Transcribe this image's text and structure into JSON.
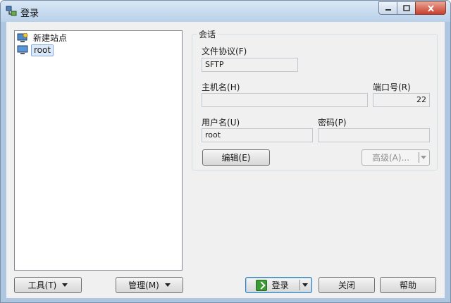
{
  "window": {
    "title": "登录"
  },
  "tree": {
    "items": [
      {
        "label": "新建站点"
      },
      {
        "label": "root"
      }
    ]
  },
  "session": {
    "group_title": "会话",
    "protocol_label": "文件协议",
    "protocol_hotkey": "(F)",
    "protocol_value": "SFTP",
    "host_label": "主机名",
    "host_hotkey": "(H)",
    "host_value": "",
    "port_label": "端口号",
    "port_hotkey": "(R)",
    "port_value": "22",
    "user_label": "用户名",
    "user_hotkey": "(U)",
    "user_value": "root",
    "password_label": "密码",
    "password_hotkey": "(P)",
    "password_value": "",
    "edit_label": "编辑",
    "edit_hotkey": "(E)",
    "advanced_label": "高级",
    "advanced_hotkey": "(A)..."
  },
  "bottom": {
    "tools_label": "工具",
    "tools_hotkey": "(T)",
    "manage_label": "管理",
    "manage_hotkey": "(M)",
    "login_label": "登录",
    "close_label": "关闭",
    "help_label": "帮助"
  },
  "colors": {
    "accent": "#3c7fb1",
    "login_green": "#3d9a35"
  }
}
